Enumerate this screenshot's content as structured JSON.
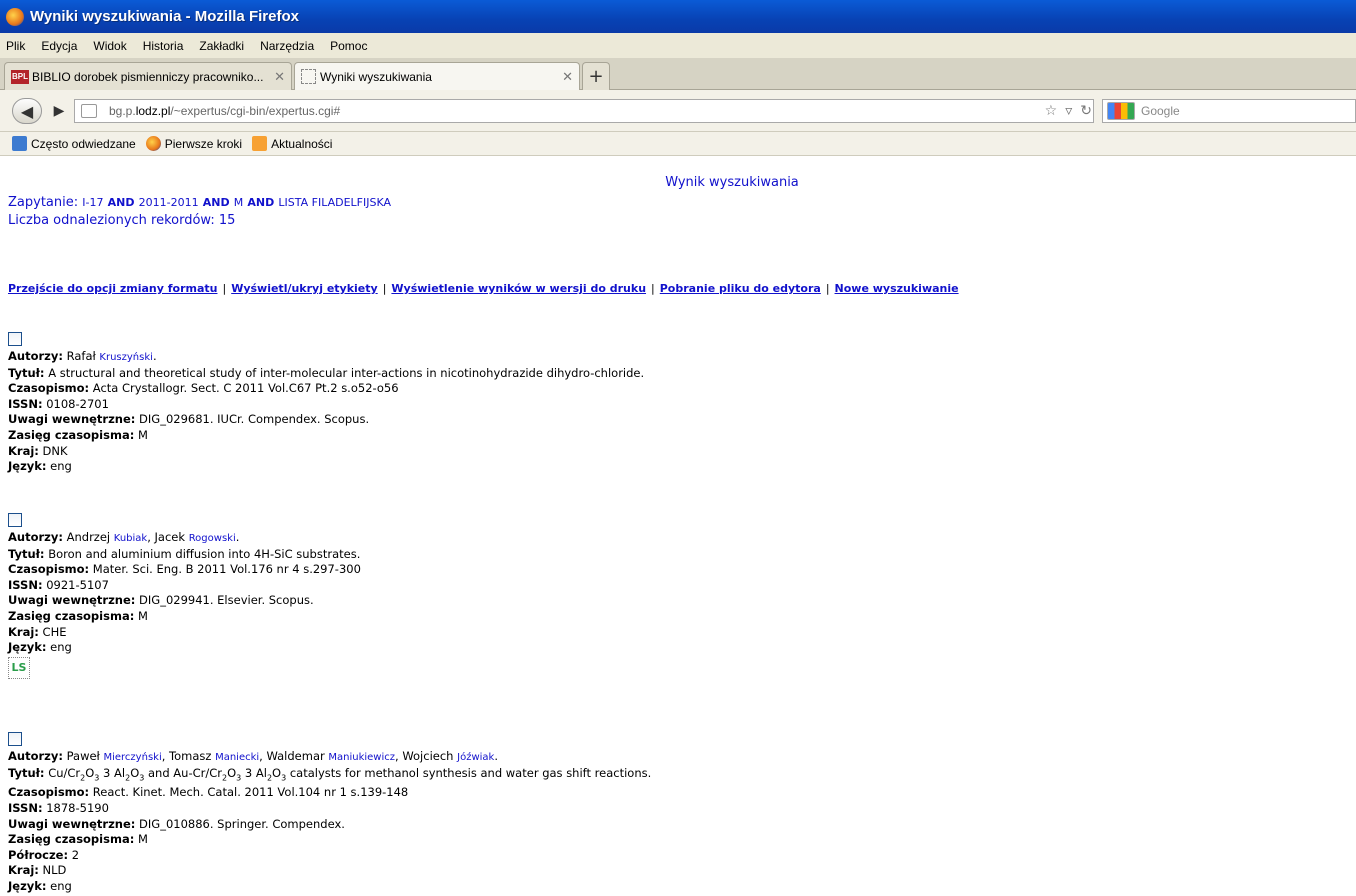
{
  "window": {
    "title": "Wyniki wyszukiwania - Mozilla Firefox"
  },
  "menu": [
    "Plik",
    "Edycja",
    "Widok",
    "Historia",
    "Zakładki",
    "Narzędzia",
    "Pomoc"
  ],
  "tabs": [
    {
      "label": "BIBLIO dorobek pismienniczy pracowniko...",
      "favicon": "BPL"
    },
    {
      "label": "Wyniki wyszukiwania"
    }
  ],
  "nav": {
    "url_prefix": "bg.p.",
    "url_host": "lodz.pl",
    "url_path": "/~expertus/cgi-bin/expertus.cgi#",
    "search_placeholder": "Google"
  },
  "bookmarks": [
    "Często odwiedzane",
    "Pierwsze kroki",
    "Aktualności"
  ],
  "page": {
    "heading": "Wynik wyszukiwania",
    "query_label": "Zapytanie:",
    "query_terms": [
      "I-17",
      "AND",
      "2011-2011",
      "AND",
      "M",
      "AND",
      "LISTA FILADELFIJSKA"
    ],
    "count_label": "Liczba odnalezionych rekordów:",
    "count_value": "15",
    "actions": [
      "Przejście do opcji zmiany formatu",
      "Wyświetl/ukryj etykiety",
      "Wyświetlenie wyników w wersji do druku",
      "Pobranie pliku do edytora",
      "Nowe wyszukiwanie"
    ]
  },
  "labels": {
    "authors": "Autorzy:",
    "title": "Tytuł:",
    "journal": "Czasopismo:",
    "issn": "ISSN:",
    "notes": "Uwagi wewnętrzne:",
    "scope": "Zasięg czasopisma:",
    "half": "Półrocze:",
    "country": "Kraj:",
    "language": "Język:"
  },
  "records": [
    {
      "authors": [
        [
          "Rafał",
          "Kruszyński"
        ]
      ],
      "title": "A structural and theoretical study of inter-molecular inter-actions in nicotinohydrazide dihydro-chloride.",
      "journal": "Acta Crystallogr. Sect. C 2011 Vol.C67 Pt.2 s.o52-o56",
      "issn": "0108-2701",
      "notes": "DIG_029681. IUCr. Compendex. Scopus.",
      "scope": "M",
      "country": "DNK",
      "language": "eng"
    },
    {
      "authors": [
        [
          "Andrzej",
          "Kubiak"
        ],
        [
          "Jacek",
          "Rogowski"
        ]
      ],
      "title": "Boron and aluminium diffusion into 4H-SiC substrates.",
      "journal": "Mater. Sci. Eng. B 2011 Vol.176 nr 4 s.297-300",
      "issn": "0921-5107",
      "notes": "DIG_029941. Elsevier. Scopus.",
      "scope": "M",
      "country": "CHE",
      "language": "eng",
      "icon": "lcs-icon"
    },
    {
      "authors": [
        [
          "Paweł",
          "Mierczyński"
        ],
        [
          "Tomasz",
          "Maniecki"
        ],
        [
          "Waldemar",
          "Maniukiewicz"
        ],
        [
          "Wojciech",
          "Jóźwiak"
        ]
      ],
      "title_parts": [
        "Cu/Cr",
        "2",
        "O",
        "3",
        " 3 Al",
        "2",
        "O",
        "3",
        " and Au-Cr/Cr",
        "2",
        "O",
        "3",
        " 3 Al",
        "2",
        "O",
        "3",
        " catalysts for methanol synthesis and water gas shift reactions."
      ],
      "journal": "React. Kinet. Mech. Catal. 2011 Vol.104 nr 1 s.139-148",
      "issn": "1878-5190",
      "notes": "DIG_010886. Springer. Compendex.",
      "scope": "M",
      "half": "2",
      "country": "NLD",
      "language": "eng"
    }
  ]
}
